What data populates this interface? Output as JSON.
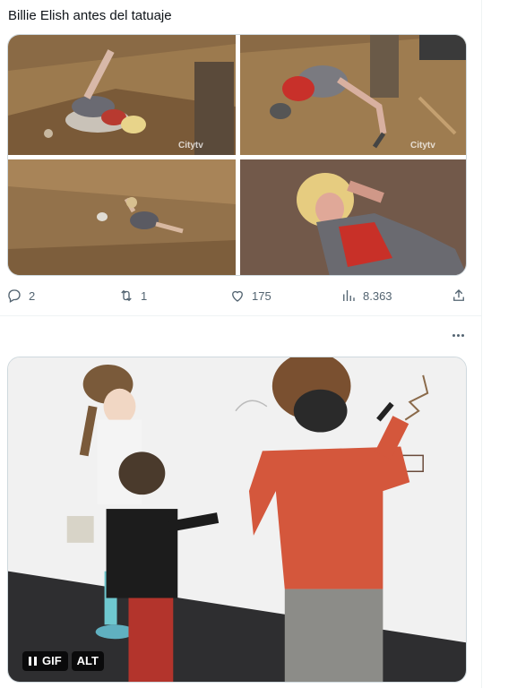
{
  "tweet1": {
    "text": "Billie Elish antes del tatuaje",
    "media": {
      "watermark": "Citytv",
      "images": [
        "top-left-frame",
        "top-right-frame",
        "bottom-left-frame",
        "bottom-right-frame"
      ]
    },
    "actions": {
      "reply_count": "2",
      "retweet_count": "1",
      "like_count": "175",
      "view_count": "8.363"
    }
  },
  "tweet2": {
    "more_label": "More",
    "media": {
      "gif_label": "GIF",
      "alt_label": "ALT"
    }
  },
  "colors": {
    "text_primary": "#0f1419",
    "text_secondary": "#536471",
    "border": "#cfd9de",
    "divider": "#eff3f4"
  },
  "icons": [
    "reply-icon",
    "retweet-icon",
    "like-icon",
    "views-icon",
    "share-icon",
    "more-icon",
    "pause-icon"
  ]
}
